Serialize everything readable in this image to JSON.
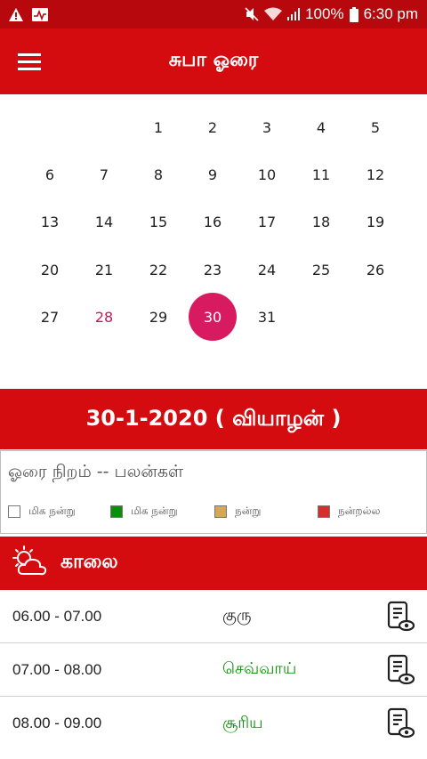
{
  "status_bar": {
    "battery": "100%",
    "time": "6:30 pm",
    "icons": [
      "warning-icon",
      "activity-icon",
      "mute-icon",
      "wifi-icon",
      "signal-icon",
      "battery-icon"
    ]
  },
  "app_bar": {
    "title": "சுபா ஓரை",
    "menu_icon": "menu-icon"
  },
  "calendar": {
    "rows": [
      [
        "",
        "",
        "1",
        "2",
        "3",
        "4",
        "5"
      ],
      [
        "6",
        "7",
        "8",
        "9",
        "10",
        "11",
        "12"
      ],
      [
        "13",
        "14",
        "15",
        "16",
        "17",
        "18",
        "19"
      ],
      [
        "20",
        "21",
        "22",
        "23",
        "24",
        "25",
        "26"
      ],
      [
        "27",
        "28",
        "29",
        "30",
        "31",
        "",
        ""
      ]
    ],
    "highlighted_day": "28",
    "selected_day": "30",
    "highlight_color": "#c2185b",
    "selected_color": "#d81b60"
  },
  "date_bar": {
    "text": "30-1-2020 ( வியாழன் )"
  },
  "legend": {
    "title": "ஓரை நிறம் -- பலன்கள்",
    "items": [
      {
        "label": "மிக நன்று",
        "color": "#ffffff"
      },
      {
        "label": "மிக நன்று",
        "color": "#0a8f0a"
      },
      {
        "label": "நன்று",
        "color": "#d4a85a"
      },
      {
        "label": "நன்றல்ல",
        "color": "#d32f2f"
      }
    ]
  },
  "section": {
    "title": "காலை",
    "icon": "weather-sun-cloud-icon"
  },
  "slots": [
    {
      "time": "06.00 - 07.00",
      "planet": "குரு",
      "color": "#222222"
    },
    {
      "time": "07.00 - 08.00",
      "planet": "செவ்வாய்",
      "color": "#0a8f0a"
    },
    {
      "time": "08.00 - 09.00",
      "planet": "சூரிய",
      "color": "#0a8f0a"
    }
  ],
  "colors": {
    "primary": "#d50c0f",
    "status_bar": "#b7080e"
  }
}
